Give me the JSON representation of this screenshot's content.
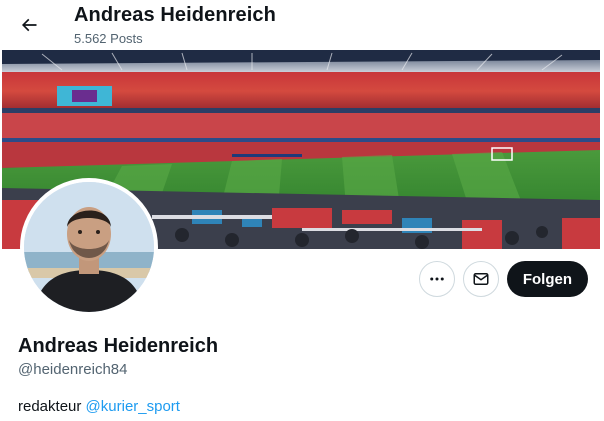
{
  "header": {
    "title": "Andreas Heidenreich",
    "posts_count": "5.562 Posts",
    "back_icon": "arrow-left-icon"
  },
  "banner": {
    "description_icon": "stadium-photo"
  },
  "actions": {
    "more_icon": "more-horizontal-icon",
    "message_icon": "envelope-icon",
    "follow_label": "Folgen"
  },
  "profile": {
    "name": "Andreas Heidenreich",
    "handle": "@heidenreich84",
    "bio_text": "redakteur ",
    "bio_mention": "@kurier_sport"
  },
  "colors": {
    "accent": "#1d9bf0",
    "follow_bg": "#0f1419",
    "muted_text": "#536471"
  }
}
